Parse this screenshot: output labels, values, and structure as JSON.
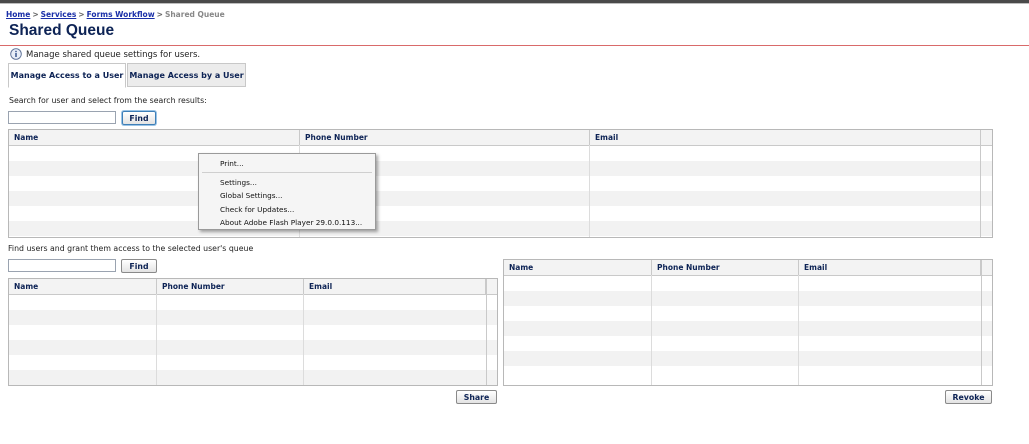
{
  "breadcrumb": {
    "home": "Home",
    "services": "Services",
    "forms_workflow": "Forms Workflow",
    "current": "Shared Queue",
    "separator": ">"
  },
  "page": {
    "title": "Shared Queue",
    "info_text": "Manage shared queue settings for users."
  },
  "tabs": [
    {
      "label": "Manage Access to a User",
      "active": true
    },
    {
      "label": "Manage Access by a User",
      "active": false
    }
  ],
  "search_section": {
    "instruction": "Search for user and select from the search results:",
    "input_value": "",
    "find_label": "Find"
  },
  "results_grid": {
    "columns": [
      "Name",
      "Phone Number",
      "Email"
    ],
    "rows": []
  },
  "grant_section": {
    "instruction": "Find users and grant them access to the selected user's queue",
    "input_value": "",
    "find_label": "Find"
  },
  "grant_grid": {
    "columns": [
      "Name",
      "Phone Number",
      "Email"
    ],
    "rows": []
  },
  "access_grid": {
    "columns": [
      "Name",
      "Phone Number",
      "Email"
    ],
    "rows": []
  },
  "actions": {
    "share_label": "Share",
    "revoke_label": "Revoke"
  },
  "context_menu": {
    "items": [
      "Print...",
      "Settings...",
      "Global Settings...",
      "Check for Updates...",
      "About Adobe Flash Player 29.0.0.113..."
    ]
  },
  "colors": {
    "title": "#0d2355",
    "link": "#1a2fa8",
    "rule": "#d96a6a"
  },
  "icons": {
    "info": "info-icon"
  }
}
